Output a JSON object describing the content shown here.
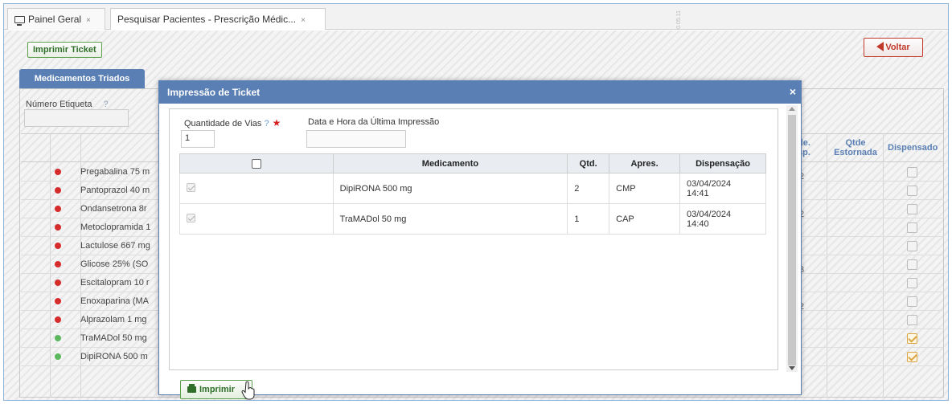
{
  "tabs": [
    {
      "label": "Painel Geral",
      "close": "×"
    },
    {
      "label": "Pesquisar Pacientes - Prescrição Médic...",
      "close": "×"
    }
  ],
  "toolbar": {
    "print_ticket_label": "Imprimir Ticket",
    "back_label": "Voltar"
  },
  "panel": {
    "tab_label": "Medicamentos Triados",
    "label_number": "Número Etiqueta",
    "label_help": "?",
    "headers": {
      "qtde_disp_part1": "de.",
      "qtde_disp_part2": "sp.",
      "qtde_estornada": "Qtde Estornada",
      "dispensado": "Dispensado"
    },
    "fragments": {
      "r1": "2",
      "r3": "2",
      "r6": "3",
      "r8": "2"
    },
    "rows": [
      {
        "name": "Pregabalina 75 m",
        "status_color": "#d62b2b",
        "dispensed": false
      },
      {
        "name": "Pantoprazol 40 m",
        "status_color": "#d62b2b",
        "dispensed": false
      },
      {
        "name": "Ondansetrona 8r",
        "status_color": "#d62b2b",
        "dispensed": false
      },
      {
        "name": "Metoclopramida 1",
        "status_color": "#d62b2b",
        "dispensed": false
      },
      {
        "name": "Lactulose 667 mg",
        "status_color": "#d62b2b",
        "dispensed": false
      },
      {
        "name": "Glicose 25% (SO",
        "status_color": "#d62b2b",
        "dispensed": false
      },
      {
        "name": "Escitalopram 10 r",
        "status_color": "#d62b2b",
        "dispensed": false
      },
      {
        "name": "Enoxaparina (MA",
        "status_color": "#d62b2b",
        "dispensed": false
      },
      {
        "name": "Alprazolam 1 mg",
        "status_color": "#d62b2b",
        "dispensed": false
      },
      {
        "name": "TraMADol 50 mg",
        "status_color": "#5cb85c",
        "dispensed": true
      },
      {
        "name": "DipiRONA 500 m",
        "status_color": "#5cb85c",
        "dispensed": true
      }
    ]
  },
  "modal": {
    "title": "Impressão de Ticket",
    "close": "×",
    "qty_label": "Quantidade de Vias",
    "qty_help": "?",
    "qty_required": "★",
    "qty_value": "1",
    "last_print_label": "Data e Hora da Última Impressão",
    "last_print_value": "",
    "table": {
      "headers": [
        "Medicamento",
        "Qtd.",
        "Apres.",
        "Dispensação"
      ],
      "rows": [
        {
          "medicamento": "DipiRONA 500 mg",
          "qtd": "2",
          "apres": "CMP",
          "date": "03/04/2024",
          "time": "14:41"
        },
        {
          "medicamento": "TraMADol 50 mg",
          "qtd": "1",
          "apres": "CAP",
          "date": "03/04/2024",
          "time": "14:40"
        }
      ]
    },
    "print_label": "Imprimir"
  },
  "version_text": "0.05.11"
}
